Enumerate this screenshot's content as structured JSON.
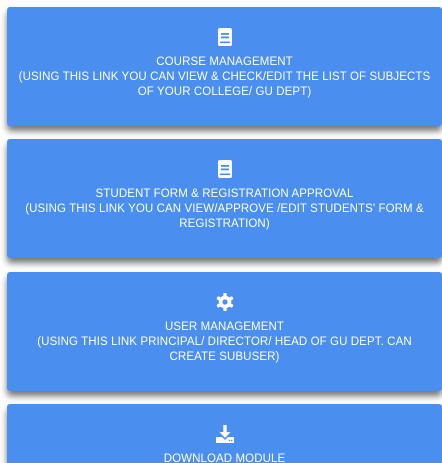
{
  "cards": [
    {
      "icon": "book-icon",
      "title": "COURSE MANAGEMENT",
      "description": "(USING THIS LINK YOU CAN VIEW & CHECK/EDIT THE LIST OF SUBJECTS OF YOUR COLLEGE/ GU DEPT)"
    },
    {
      "icon": "book-icon",
      "title": "STUDENT FORM & REGISTRATION APPROVAL",
      "description": "(USING THIS LINK YOU CAN VIEW/APPROVE /EDIT STUDENTS' FORM & REGISTRATION)"
    },
    {
      "icon": "gear-icon",
      "title": "USER MANAGEMENT",
      "description": "(USING THIS LINK PRINCIPAL/ DIRECTOR/ HEAD OF GU DEPT. CAN CREATE SUBUSER)"
    },
    {
      "icon": "download-icon",
      "title": "DOWNLOAD MODULE",
      "description": ""
    }
  ],
  "colors": {
    "card_background": "#4a8ef0",
    "text": "#ffffff"
  }
}
